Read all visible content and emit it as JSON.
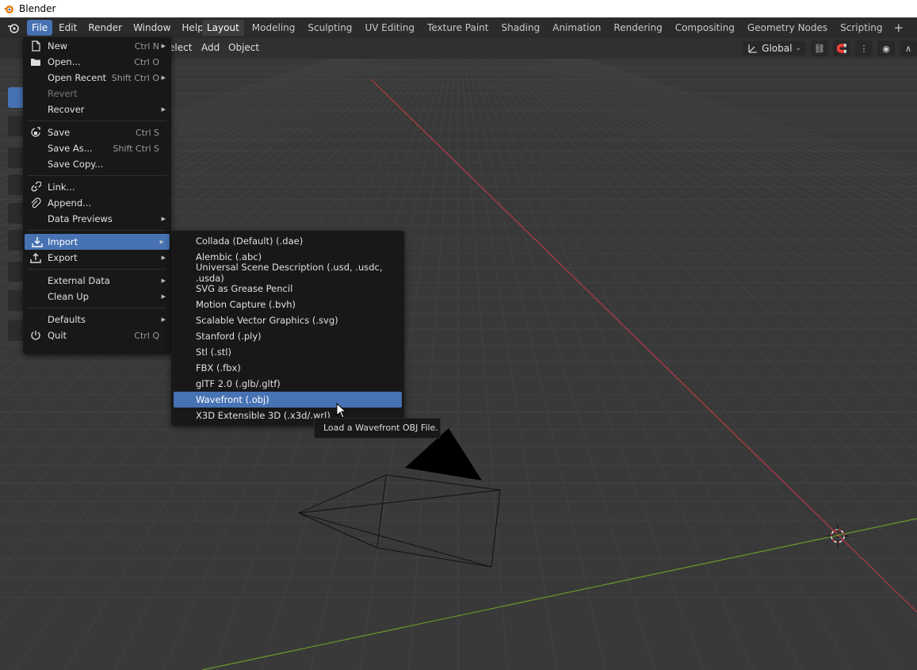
{
  "window": {
    "title": "Blender"
  },
  "menubar": {
    "items": [
      "File",
      "Edit",
      "Render",
      "Window",
      "Help"
    ],
    "active": "File"
  },
  "workspaces": {
    "tabs": [
      "Layout",
      "Modeling",
      "Sculpting",
      "UV Editing",
      "Texture Paint",
      "Shading",
      "Animation",
      "Rendering",
      "Compositing",
      "Geometry Nodes",
      "Scripting"
    ],
    "active": "Layout",
    "add_label": "+"
  },
  "viewport_header": {
    "select_label": "elect",
    "add_label": "Add",
    "object_label": "Object",
    "transform_orientation": "Global"
  },
  "file_menu": {
    "items": [
      {
        "label": "New",
        "shortcut": "Ctrl N",
        "icon": "new-file-icon",
        "submenu": true
      },
      {
        "label": "Open...",
        "shortcut": "Ctrl O",
        "icon": "folder-icon"
      },
      {
        "label": "Open Recent",
        "shortcut": "Shift Ctrl O",
        "submenu": true
      },
      {
        "label": "Revert",
        "disabled": true
      },
      {
        "label": "Recover",
        "submenu": true
      },
      {
        "label": "Save",
        "shortcut": "Ctrl S",
        "icon": "save-icon"
      },
      {
        "label": "Save As...",
        "shortcut": "Shift Ctrl S"
      },
      {
        "label": "Save Copy..."
      },
      {
        "label": "Link...",
        "icon": "link-icon"
      },
      {
        "label": "Append...",
        "icon": "append-icon"
      },
      {
        "label": "Data Previews",
        "submenu": true
      },
      {
        "label": "Import",
        "icon": "import-icon",
        "submenu": true,
        "highlighted": true
      },
      {
        "label": "Export",
        "icon": "export-icon",
        "submenu": true
      },
      {
        "label": "External Data",
        "submenu": true
      },
      {
        "label": "Clean Up",
        "submenu": true
      },
      {
        "label": "Defaults",
        "submenu": true
      },
      {
        "label": "Quit",
        "shortcut": "Ctrl Q",
        "icon": "quit-icon"
      }
    ]
  },
  "import_submenu": {
    "items": [
      "Collada (Default) (.dae)",
      "Alembic (.abc)",
      "Universal Scene Description (.usd, .usdc, .usda)",
      "SVG as Grease Pencil",
      "Motion Capture (.bvh)",
      "Scalable Vector Graphics (.svg)",
      "Stanford (.ply)",
      "Stl (.stl)",
      "FBX (.fbx)",
      "glTF 2.0 (.glb/.gltf)",
      "Wavefront (.obj)",
      "X3D Extensible 3D (.x3d/.wrl)"
    ],
    "highlighted": "Wavefront (.obj)"
  },
  "tooltip": {
    "text": "Load a Wavefront OBJ File."
  },
  "colors": {
    "accent": "#4772b3",
    "menu_bg": "#181818",
    "viewport_bg": "#393939",
    "x_axis": "#b53a43",
    "y_axis": "#6c9a2a"
  }
}
